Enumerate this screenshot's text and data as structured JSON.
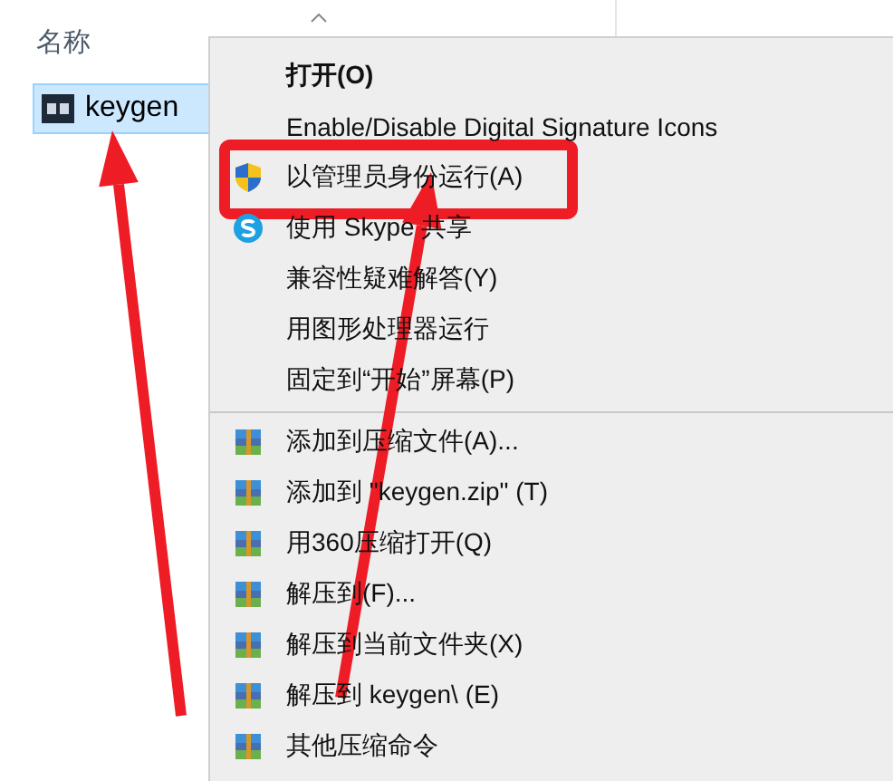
{
  "file_list": {
    "column_header": "名称",
    "files": [
      {
        "name": "keygen",
        "selected": true
      }
    ]
  },
  "context_menu": {
    "items": [
      {
        "kind": "bold",
        "label": "打开(O)"
      },
      {
        "kind": "plain",
        "label": "Enable/Disable Digital Signature Icons"
      },
      {
        "kind": "shield",
        "label": "以管理员身份运行(A)"
      },
      {
        "kind": "skype",
        "label": "使用 Skype 共享"
      },
      {
        "kind": "plain",
        "label": "兼容性疑难解答(Y)"
      },
      {
        "kind": "plain",
        "label": "用图形处理器运行"
      },
      {
        "kind": "plain",
        "label": "固定到“开始”屏幕(P)"
      },
      {
        "kind": "separator"
      },
      {
        "kind": "archive",
        "label": "添加到压缩文件(A)..."
      },
      {
        "kind": "archive",
        "label": "添加到 \"keygen.zip\" (T)"
      },
      {
        "kind": "archive",
        "label": "用360压缩打开(Q)"
      },
      {
        "kind": "archive",
        "label": "解压到(F)..."
      },
      {
        "kind": "archive",
        "label": "解压到当前文件夹(X)"
      },
      {
        "kind": "archive",
        "label": "解压到 keygen\\ (E)"
      },
      {
        "kind": "archive",
        "label": "其他压缩命令"
      }
    ]
  }
}
